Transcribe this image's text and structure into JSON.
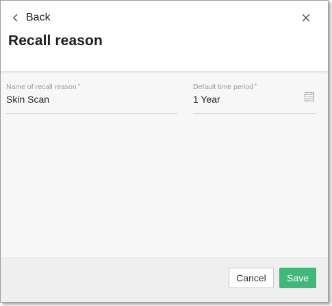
{
  "header": {
    "back_label": "Back",
    "title": "Recall reason",
    "back_icon": "chevron-left-icon",
    "close_icon": "close-icon"
  },
  "form": {
    "name_field": {
      "label": "Name of recall reason",
      "required_marker": "*",
      "value": "Skin Scan"
    },
    "period_field": {
      "label": "Default time period",
      "required_marker": "*",
      "value": "1 Year",
      "icon": "calendar-icon"
    }
  },
  "footer": {
    "cancel_label": "Cancel",
    "save_label": "Save"
  },
  "colors": {
    "save_button": "#3fb87a",
    "body_background": "#f7f7f7",
    "header_background": "#ffffff"
  }
}
